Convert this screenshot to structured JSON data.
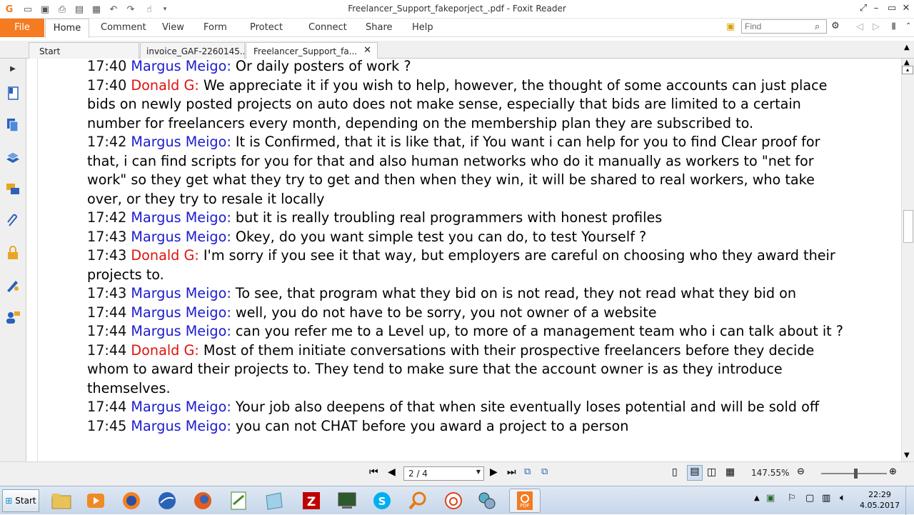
{
  "window": {
    "title": "Freelancer_Support_fakeporject_.pdf - Foxit Reader"
  },
  "ribbon": {
    "file": "File",
    "tabs": [
      "Home",
      "Comment",
      "View",
      "Form",
      "Protect",
      "Connect",
      "Share",
      "Help"
    ],
    "find_placeholder": "Find"
  },
  "doc_tabs": [
    {
      "label": "Start"
    },
    {
      "label": "invoice_GAF-2260145..."
    },
    {
      "label": "Freelancer_Support_fa..."
    }
  ],
  "messages": [
    {
      "time": "17:40",
      "name": "Margus Meigo:",
      "speaker": "margus",
      "text": " Or daily posters of work ?"
    },
    {
      "time": "17:40",
      "name": "Donald G:",
      "speaker": "donald",
      "text": " We appreciate it if you wish to help, however, the thought of some accounts can just place bids on newly posted projects on auto does not make sense, especially that bids are limited to a certain number for freelancers every month, depending on the membership plan they are subscribed to."
    },
    {
      "time": "17:42",
      "name": "Margus Meigo:",
      "speaker": "margus",
      "text": " It is Confirmed, that it is like that, if You want i can help for you to find Clear proof for that, i can find scripts for you for that and also human networks who do it manually as workers to \"net for work\" so they get what they try to get and then when they win, it will be shared to real workers, who take over, or they try to resale it locally"
    },
    {
      "time": "17:42",
      "name": "Margus Meigo:",
      "speaker": "margus",
      "text": " but it is really troubling real programmers with honest profiles"
    },
    {
      "time": "17:43",
      "name": "Margus Meigo:",
      "speaker": "margus",
      "text": " Okey, do you want simple test you can do, to test Yourself ?"
    },
    {
      "time": "17:43",
      "name": "Donald G:",
      "speaker": "donald",
      "text": " I'm sorry if you see it that way, but employers are careful on choosing who they award their projects to."
    },
    {
      "time": "17:43",
      "name": "Margus Meigo:",
      "speaker": "margus",
      "text": " To see, that program what they bid on is not read, they not read what they bid on"
    },
    {
      "time": "17:44",
      "name": "Margus Meigo:",
      "speaker": "margus",
      "text": " well, you do not have to be sorry, you not owner of a website"
    },
    {
      "time": "17:44",
      "name": "Margus Meigo:",
      "speaker": "margus",
      "text": " can you refer me to a Level up, to more of a management team who i can talk about it ?"
    },
    {
      "time": "17:44",
      "name": "Donald G:",
      "speaker": "donald",
      "text": " Most of them initiate conversations with their prospective freelancers before they decide whom to award their projects to. They tend to make sure that the account owner is as they introduce themselves."
    },
    {
      "time": "17:44",
      "name": "Margus Meigo:",
      "speaker": "margus",
      "text": " Your job also deepens of that when site eventually loses potential and will be sold off"
    },
    {
      "time": "17:45",
      "name": "Margus Meigo:",
      "speaker": "margus",
      "text": " you can not CHAT before you award a project to a person"
    }
  ],
  "statusbar": {
    "page": "2 / 4",
    "zoom": "147.55%"
  },
  "taskbar": {
    "start": "Start",
    "time": "22:29",
    "date": "4.05.2017"
  },
  "colors": {
    "accent": "#f47b20",
    "margus": "#1b1bcf",
    "donald": "#e0120c"
  }
}
